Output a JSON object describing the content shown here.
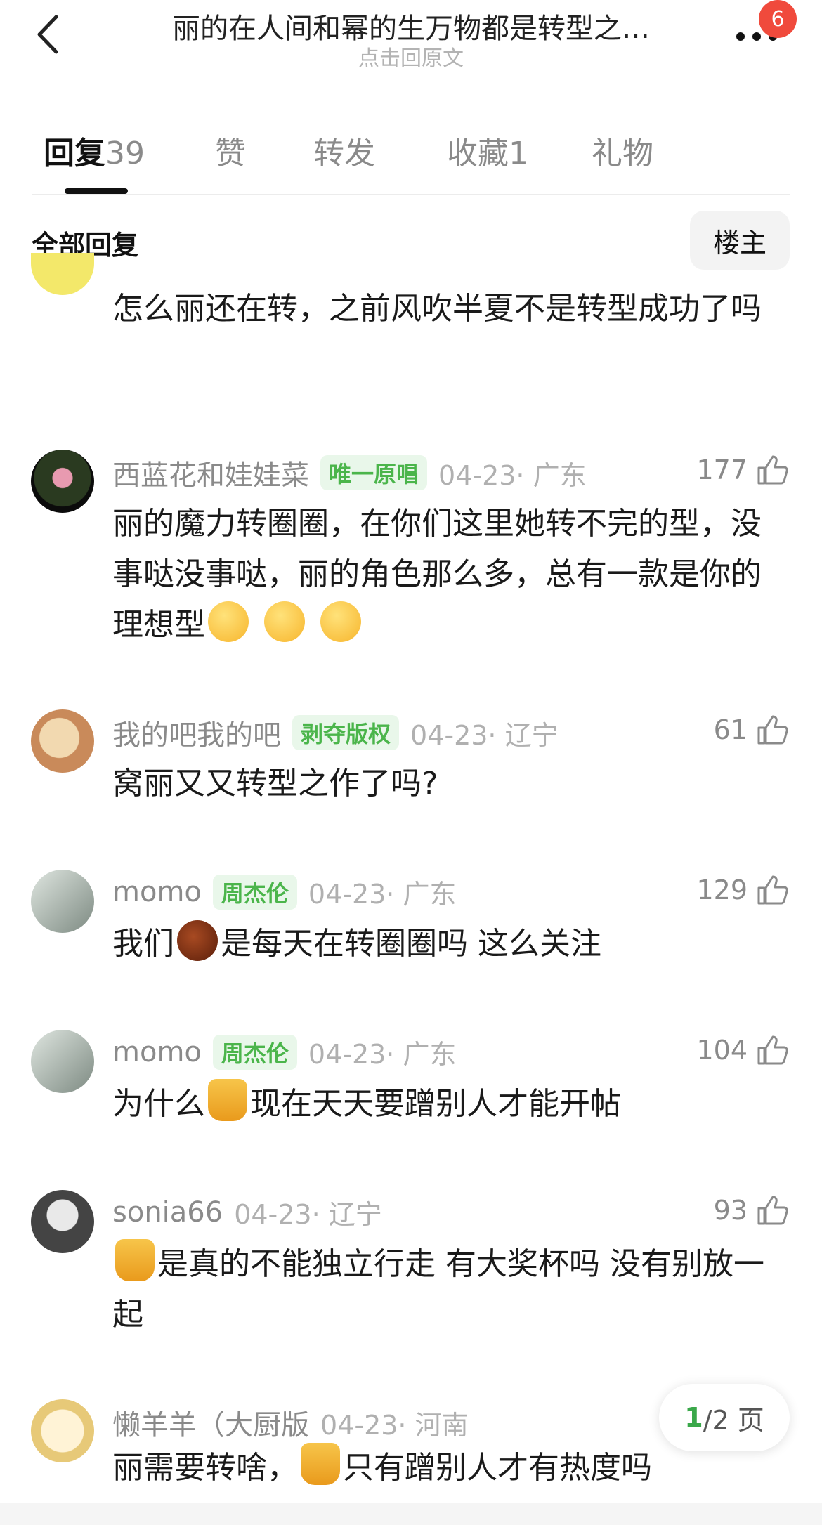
{
  "header": {
    "title": "丽的在人间和幂的生万物都是转型之…",
    "subtitle": "点击回原文",
    "badge": "6"
  },
  "tabs": [
    {
      "label": "回复",
      "count": "39"
    },
    {
      "label": "赞",
      "count": ""
    },
    {
      "label": "转发",
      "count": ""
    },
    {
      "label": "收藏",
      "count": "1"
    },
    {
      "label": "礼物",
      "count": ""
    }
  ],
  "filter": {
    "label": "全部回复",
    "owner_button": "楼主"
  },
  "comments": [
    {
      "text_parts": [
        "怎么丽还在转，之前风吹半夏不是转型成功了吗"
      ]
    },
    {
      "name": "西蓝花和娃娃菜",
      "tag": "唯一原唱",
      "meta": "04-23· 广东",
      "likes": "177",
      "text_parts": [
        "丽的魔力转圈圈，在你们这里她转不完的型，没事哒没事哒，丽的角色那么多，总有一款是你的理想型"
      ]
    },
    {
      "name": "我的吧我的吧",
      "tag": "剥夺版权",
      "meta": "04-23· 辽宁",
      "likes": "61",
      "text_parts": [
        "窝丽又又转型之作了吗?"
      ]
    },
    {
      "name": "momo",
      "tag": "周杰伦",
      "meta": "04-23· 广东",
      "likes": "129",
      "text_parts": [
        "我们",
        "是每天在转圈圈吗 这么关注"
      ]
    },
    {
      "name": "momo",
      "tag": "周杰伦",
      "meta": "04-23· 广东",
      "likes": "104",
      "text_parts": [
        "为什么",
        "现在天天要蹭别人才能开帖"
      ]
    },
    {
      "name": "sonia66",
      "tag": "",
      "meta": "04-23· 辽宁",
      "likes": "93",
      "text_parts": [
        "是真的不能独立行走 有大奖杯吗 没有别放一起"
      ]
    },
    {
      "name": "懒羊羊（大厨版",
      "tag": "",
      "meta": "04-23· 河南",
      "likes": "",
      "text_parts": [
        "丽需要转啥，",
        "只有蹭别人才有热度吗"
      ]
    }
  ],
  "pager": {
    "current": "1",
    "total": "/2 页"
  },
  "icons": [
    "back-arrow-icon",
    "more-dots-icon",
    "thumbs-up-icon",
    "grinning-sweat-emoji",
    "chestnut-emoji",
    "honey-pot-emoji"
  ],
  "colors": {
    "tag_green": "#4bb54b",
    "badge_red": "#f04a3c"
  }
}
